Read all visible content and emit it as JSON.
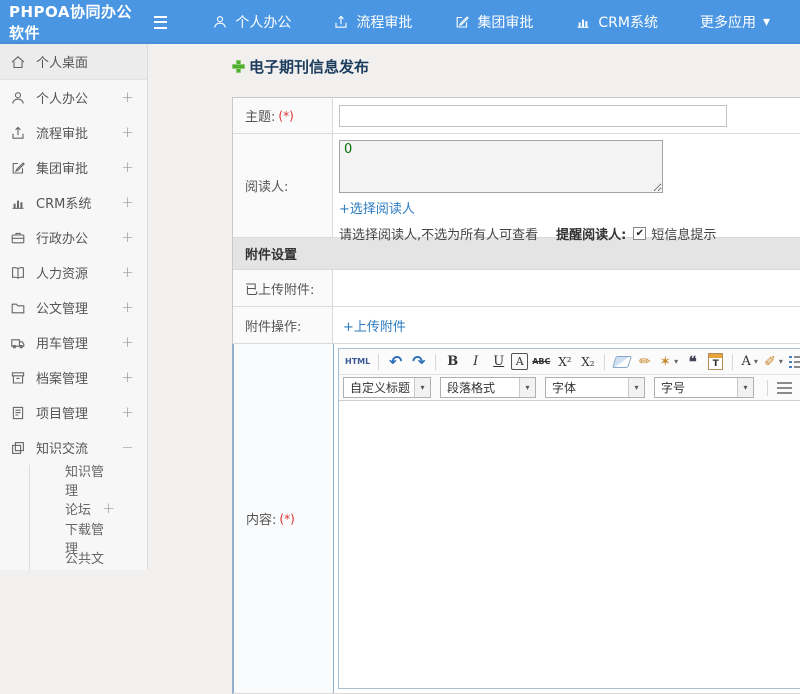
{
  "topbar": {
    "brand": "PHPOA协同办公软件",
    "nav": [
      {
        "key": "personal-office",
        "icon": "user",
        "label": "个人办公"
      },
      {
        "key": "workflow-approval",
        "icon": "flow",
        "label": "流程审批"
      },
      {
        "key": "group-approval",
        "icon": "edit-square",
        "label": "集团审批"
      },
      {
        "key": "crm-system",
        "icon": "chart",
        "label": "CRM系统"
      },
      {
        "key": "more-apps",
        "icon": "caret",
        "label": "更多应用"
      }
    ]
  },
  "sidebar": {
    "items": [
      {
        "key": "personal-desktop",
        "icon": "home",
        "label": "个人桌面",
        "active": true
      },
      {
        "key": "personal-office",
        "icon": "user",
        "label": "个人办公",
        "expander": "+"
      },
      {
        "key": "workflow-approval",
        "icon": "flow",
        "label": "流程审批",
        "expander": "+"
      },
      {
        "key": "group-approval",
        "icon": "edit-square",
        "label": "集团审批",
        "expander": "+"
      },
      {
        "key": "crm-system",
        "icon": "chart",
        "label": "CRM系统",
        "expander": "+"
      },
      {
        "key": "admin-office",
        "icon": "briefcase",
        "label": "行政办公",
        "expander": "+"
      },
      {
        "key": "human-resources",
        "icon": "book",
        "label": "人力资源",
        "expander": "+"
      },
      {
        "key": "document-management",
        "icon": "folder",
        "label": "公文管理",
        "expander": "+"
      },
      {
        "key": "vehicle-management",
        "icon": "truck",
        "label": "用车管理",
        "expander": "+"
      },
      {
        "key": "archive-management",
        "icon": "archive",
        "label": "档案管理",
        "expander": "+"
      },
      {
        "key": "project-management",
        "icon": "project",
        "label": "项目管理",
        "expander": "+"
      },
      {
        "key": "knowledge-exchange",
        "icon": "layers",
        "label": "知识交流",
        "expander": "−",
        "children": [
          {
            "key": "knowledge-management",
            "label": "知识管理"
          },
          {
            "key": "forum",
            "label": "论坛",
            "expander": "+"
          },
          {
            "key": "download-management",
            "label": "下载管理"
          },
          {
            "key": "public-file-cabinet",
            "label": "公共文件柜"
          }
        ]
      }
    ]
  },
  "main": {
    "page_title": "电子期刊信息发布",
    "form": {
      "subject_label": "主题:",
      "required_mark": "(*)",
      "subject_value": "",
      "readers_label": "阅读人:",
      "readers_value": "0",
      "select_readers_link": "+选择阅读人",
      "readers_hint": "请选择阅读人,不选为所有人可查看",
      "remind_readers_label": "提醒阅读人:",
      "sms_notify_label": "短信息提示",
      "sms_notify_checked": true,
      "attachment_section_title": "附件设置",
      "uploaded_attachment_label": "已上传附件:",
      "attachment_action_label": "附件操作:",
      "upload_attachment_link": "+上传附件",
      "content_label": "内容:"
    },
    "editor": {
      "row1": [
        {
          "name": "html-source",
          "glyph": "HTML"
        },
        {
          "name": "sep"
        },
        {
          "name": "undo",
          "glyph": "↶"
        },
        {
          "name": "redo",
          "glyph": "↷"
        },
        {
          "name": "sep"
        },
        {
          "name": "bold",
          "glyph": "B"
        },
        {
          "name": "italic",
          "glyph": "I"
        },
        {
          "name": "underline",
          "glyph": "U"
        },
        {
          "name": "font-style",
          "glyph": "A"
        },
        {
          "name": "strikethrough",
          "glyph": "ABC"
        },
        {
          "name": "superscript",
          "glyph": "X²"
        },
        {
          "name": "subscript",
          "glyph": "X₂"
        },
        {
          "name": "sep"
        },
        {
          "name": "remove-format"
        },
        {
          "name": "format-brush",
          "glyph": "✏"
        },
        {
          "name": "auto-typeset",
          "glyph": "✶"
        },
        {
          "name": "blockquote",
          "glyph": "❝"
        },
        {
          "name": "paste-as-text"
        },
        {
          "name": "sep"
        },
        {
          "name": "font-color",
          "glyph": "A"
        },
        {
          "name": "highlight",
          "glyph": "✐"
        },
        {
          "name": "ordered-list"
        },
        {
          "name": "unordered-list"
        }
      ],
      "row2": [
        {
          "name": "heading-select",
          "label": "自定义标题"
        },
        {
          "name": "paragraph-select",
          "label": "段落格式"
        },
        {
          "name": "font-family-select",
          "label": "字体"
        },
        {
          "name": "font-size-select",
          "label": "字号"
        },
        {
          "name": "sep"
        },
        {
          "name": "align-left"
        },
        {
          "name": "align-center"
        },
        {
          "name": "align-right"
        },
        {
          "name": "align-justify"
        },
        {
          "name": "link"
        },
        {
          "name": "unlink"
        },
        {
          "name": "insert-image"
        },
        {
          "name": "insert-multi-image"
        }
      ]
    }
  }
}
